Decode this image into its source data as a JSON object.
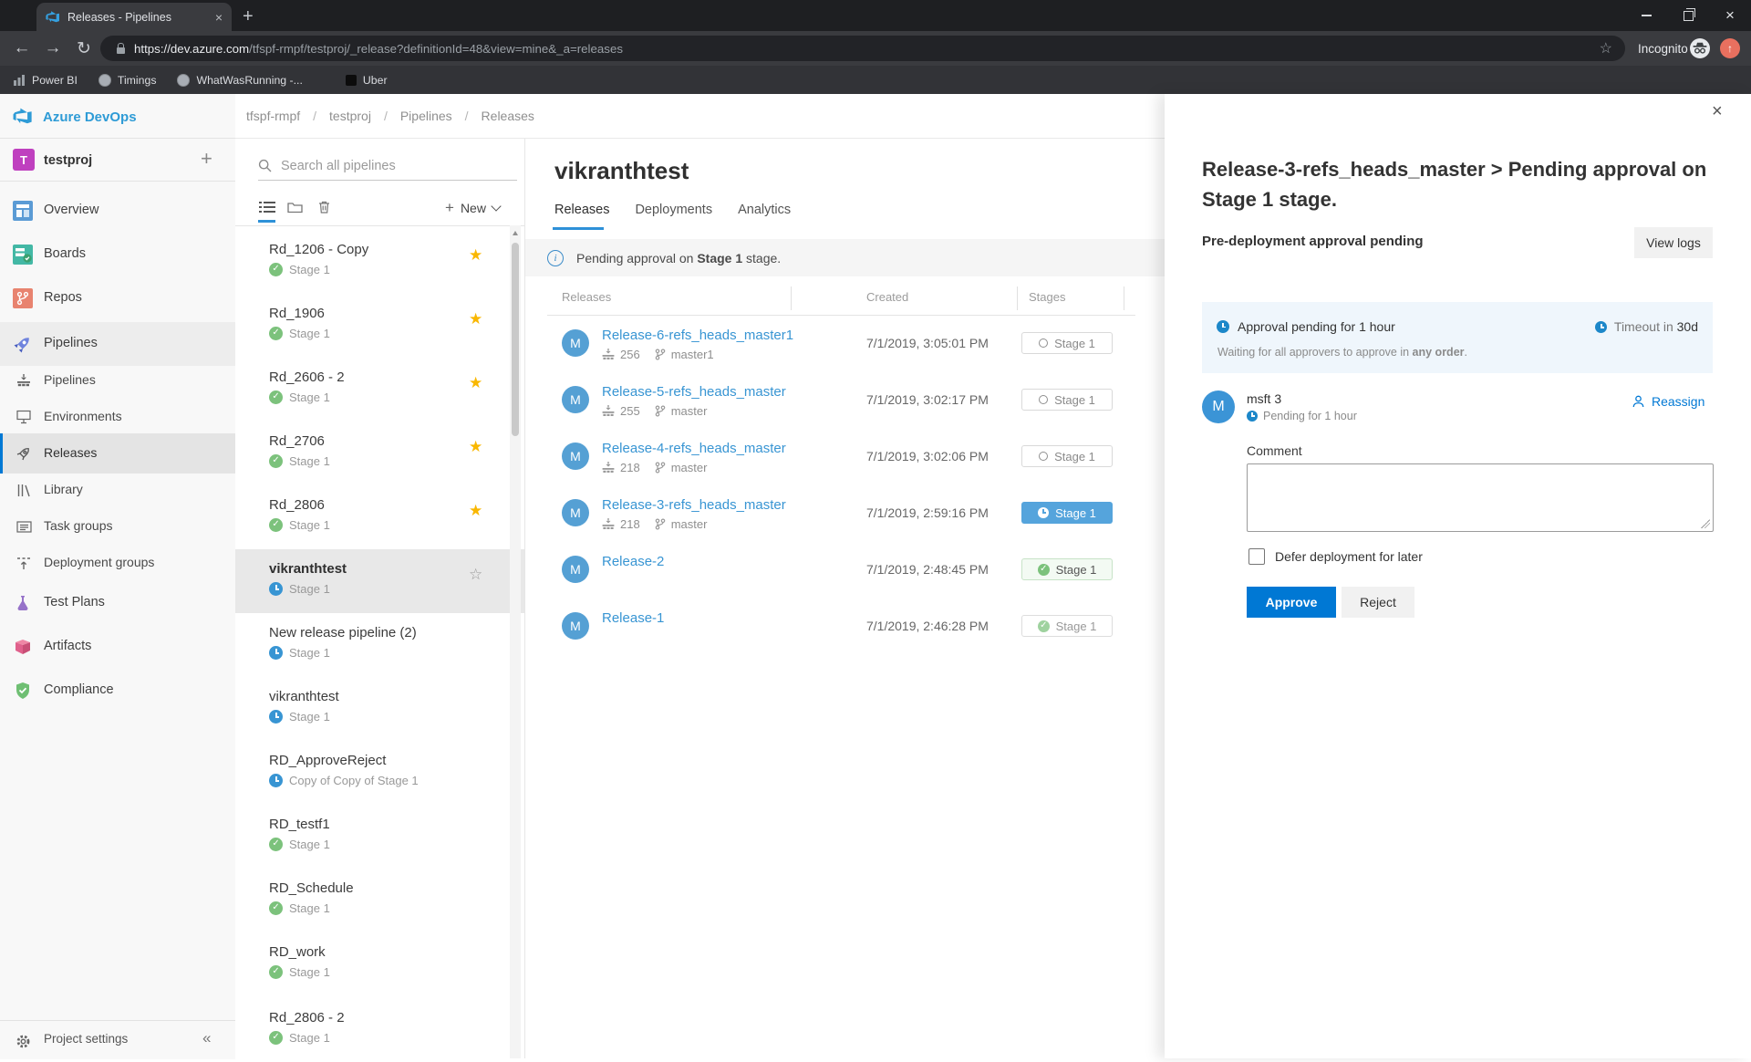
{
  "browser": {
    "tab_title": "Releases - Pipelines",
    "url_host": "https://dev.azure.com",
    "url_path": "/tfspf-rmpf/testproj/_release?definitionId=48&view=mine&_a=releases",
    "incognito_label": "Incognito",
    "bookmarks": [
      {
        "label": "Power BI"
      },
      {
        "label": "Timings"
      },
      {
        "label": "WhatWasRunning -..."
      },
      {
        "label": "Uber"
      }
    ]
  },
  "icons": {
    "close": "×",
    "plus": "+",
    "back": "←",
    "forward": "→",
    "reload": "↻",
    "star_filled": "★",
    "star_outline": "☆",
    "collapse": "«",
    "info": "i",
    "up_arrow": "↑"
  },
  "nav": {
    "brand": "Azure DevOps",
    "project": "testproj",
    "project_initial": "T",
    "items": [
      {
        "label": "Overview"
      },
      {
        "label": "Boards"
      },
      {
        "label": "Repos"
      },
      {
        "label": "Pipelines"
      }
    ],
    "sub_items": [
      {
        "label": "Pipelines"
      },
      {
        "label": "Environments"
      },
      {
        "label": "Releases"
      },
      {
        "label": "Library"
      },
      {
        "label": "Task groups"
      },
      {
        "label": "Deployment groups"
      }
    ],
    "items2": [
      {
        "label": "Test Plans"
      },
      {
        "label": "Artifacts"
      },
      {
        "label": "Compliance"
      }
    ],
    "project_settings": "Project settings"
  },
  "breadcrumb": [
    {
      "label": "tfspf-rmpf"
    },
    {
      "label": "testproj"
    },
    {
      "label": "Pipelines"
    },
    {
      "label": "Releases"
    }
  ],
  "pipelines_panel": {
    "search_placeholder": "Search all pipelines",
    "new_label": "New",
    "items": [
      {
        "name": "Rd_1206 - Copy",
        "stage": "Stage 1",
        "status": "success",
        "star": "filled"
      },
      {
        "name": "Rd_1906",
        "stage": "Stage 1",
        "status": "success",
        "star": "filled"
      },
      {
        "name": "Rd_2606 - 2",
        "stage": "Stage 1",
        "status": "success",
        "star": "filled"
      },
      {
        "name": "Rd_2706",
        "stage": "Stage 1",
        "status": "success",
        "star": "filled"
      },
      {
        "name": "Rd_2806",
        "stage": "Stage 1",
        "status": "success",
        "star": "filled"
      },
      {
        "name": "vikranthtest",
        "stage": "Stage 1",
        "status": "pending",
        "star": "outline",
        "selected": true
      },
      {
        "name": "New release pipeline (2)",
        "stage": "Stage 1",
        "status": "pending",
        "star": "none"
      },
      {
        "name": "vikranthtest",
        "stage": "Stage 1",
        "status": "pending",
        "star": "none"
      },
      {
        "name": "RD_ApproveReject",
        "stage": "Copy of Copy of Stage 1",
        "status": "pending",
        "star": "none"
      },
      {
        "name": "RD_testf1",
        "stage": "Stage 1",
        "status": "success",
        "star": "none"
      },
      {
        "name": "RD_Schedule",
        "stage": "Stage 1",
        "status": "success",
        "star": "none"
      },
      {
        "name": "RD_work",
        "stage": "Stage 1",
        "status": "success",
        "star": "none"
      },
      {
        "name": "Rd_2806 - 2",
        "stage": "Stage 1",
        "status": "success",
        "star": "none"
      }
    ]
  },
  "main": {
    "title": "vikranthtest",
    "tabs": [
      {
        "label": "Releases"
      },
      {
        "label": "Deployments"
      },
      {
        "label": "Analytics"
      }
    ],
    "banner": {
      "prefix": "Pending approval on ",
      "strong": "Stage 1",
      "suffix": " stage."
    },
    "table": {
      "headers": [
        {
          "label": "Releases"
        },
        {
          "label": "Created"
        },
        {
          "label": "Stages"
        }
      ],
      "avatar_initial": "M",
      "rows": [
        {
          "name": "Release-6-refs_heads_master1",
          "build": "256",
          "branch": "master1",
          "created": "7/1/2019, 3:05:01 PM",
          "stage": "Stage 1",
          "state": "not-deployed"
        },
        {
          "name": "Release-5-refs_heads_master",
          "build": "255",
          "branch": "master",
          "created": "7/1/2019, 3:02:17 PM",
          "stage": "Stage 1",
          "state": "not-deployed"
        },
        {
          "name": "Release-4-refs_heads_master",
          "build": "218",
          "branch": "master",
          "created": "7/1/2019, 3:02:06 PM",
          "stage": "Stage 1",
          "state": "not-deployed"
        },
        {
          "name": "Release-3-refs_heads_master",
          "build": "218",
          "branch": "master",
          "created": "7/1/2019, 2:59:16 PM",
          "stage": "Stage 1",
          "state": "in-progress"
        },
        {
          "name": "Release-2",
          "created": "7/1/2019, 2:48:45 PM",
          "stage": "Stage 1",
          "state": "succeeded"
        },
        {
          "name": "Release-1",
          "created": "7/1/2019, 2:46:28 PM",
          "stage": "Stage 1",
          "state": "succeeded-muted"
        }
      ]
    }
  },
  "panel": {
    "title": "Release-3-refs_heads_master > Pending approval on Stage 1 stage.",
    "status": "Pre-deployment approval pending",
    "view_logs": "View logs",
    "info": {
      "pending": "Approval pending for 1 hour",
      "timeout_prefix": "Timeout in ",
      "timeout_value": "30d",
      "waiting_prefix": "Waiting for all approvers to approve in ",
      "waiting_strong": "any order",
      "waiting_suffix": "."
    },
    "approver": {
      "initial": "M",
      "name": "msft 3",
      "pending": "Pending for 1 hour",
      "reassign": "Reassign"
    },
    "comment_label": "Comment",
    "defer_label": "Defer deployment for later",
    "approve_label": "Approve",
    "reject_label": "Reject"
  },
  "colors": {
    "accent": "#0078d4",
    "link_blue": "#3895d3",
    "pending_blue": "#3895d3",
    "success_green": "#7cc27c",
    "star_gold": "#f9b700",
    "active_stage_blue": "#55a4dc",
    "info_box_bg": "#eff6fc"
  }
}
